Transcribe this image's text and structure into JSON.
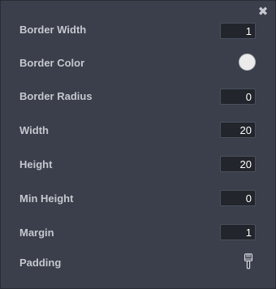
{
  "panel": {
    "close_icon": "close-icon",
    "close_glyph": "✖",
    "fields": [
      {
        "label": "Border Width",
        "value": "1"
      },
      {
        "label": "Border Radius",
        "value": "0"
      },
      {
        "label": "Width",
        "value": "20"
      },
      {
        "label": "Height",
        "value": "20"
      },
      {
        "label": "Min Height",
        "value": "0"
      },
      {
        "label": "Margin",
        "value": "1"
      }
    ],
    "border_color": {
      "label": "Border Color",
      "value": "#ebebeb"
    },
    "padding": {
      "label": "Padding",
      "icon": "brush-icon"
    }
  },
  "colors": {
    "panel_bg": "#3b3f4b",
    "label_text": "#c4c7ce",
    "input_bg": "#22252c",
    "input_text": "#ffffff"
  }
}
